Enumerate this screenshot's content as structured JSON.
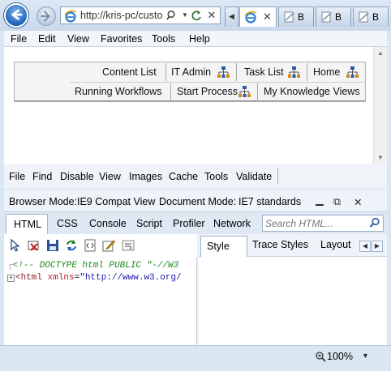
{
  "browser": {
    "address": {
      "url": "http://kris-pc/custo",
      "search_icon": "search-icon",
      "dropdown_icon": "chevron-down-icon",
      "refresh_icon": "refresh-icon",
      "stop_icon": "close-icon"
    },
    "tabs": [
      {
        "label": "",
        "active": true,
        "close": "✕"
      },
      {
        "label": "B",
        "active": false
      },
      {
        "label": "B",
        "active": false
      },
      {
        "label": "B",
        "active": false
      }
    ],
    "tab_scroll_arrow": "◀"
  },
  "menu": [
    "File",
    "Edit",
    "View",
    "Favorites",
    "Tools",
    "Help"
  ],
  "page": {
    "row1": [
      "Content List",
      "IT Admin",
      "Task List",
      "Home"
    ],
    "row2": [
      "Running Workflows",
      "Start Process",
      "My Knowledge Views"
    ]
  },
  "devtools": {
    "menu": [
      "File",
      "Find",
      "Disable",
      "View",
      "Images",
      "Cache",
      "Tools",
      "Validate"
    ],
    "browser_mode_label": "Browser Mode:",
    "browser_mode_value": "IE9 Compat View",
    "document_mode_label": "Document Mode:",
    "document_mode_value": "IE7 standards",
    "window_buttons": {
      "minimize": "▁",
      "restore": "⧉",
      "close": "✕"
    },
    "tabs": [
      "HTML",
      "CSS",
      "Console",
      "Script",
      "Profiler",
      "Network"
    ],
    "search_placeholder": "Search HTML...",
    "code": {
      "line1": "<!-- DOCTYPE html PUBLIC \"-//W3",
      "line2_tag": "<html",
      "line2_attr": " xmlns",
      "line2_eq": "=",
      "line2_val": "\"http://www.w3.org/"
    },
    "right_tabs": [
      "Style",
      "Trace Styles",
      "Layout"
    ],
    "right_arrows": {
      "left": "◀",
      "right": "▶"
    }
  },
  "status": {
    "zoom": "100%",
    "zoom_dropdown": "▼"
  },
  "colors": {
    "accent": "#1f63b8",
    "comment": "#1a8a1a",
    "tag": "#8b1a1a",
    "value": "#1a1aa6"
  }
}
